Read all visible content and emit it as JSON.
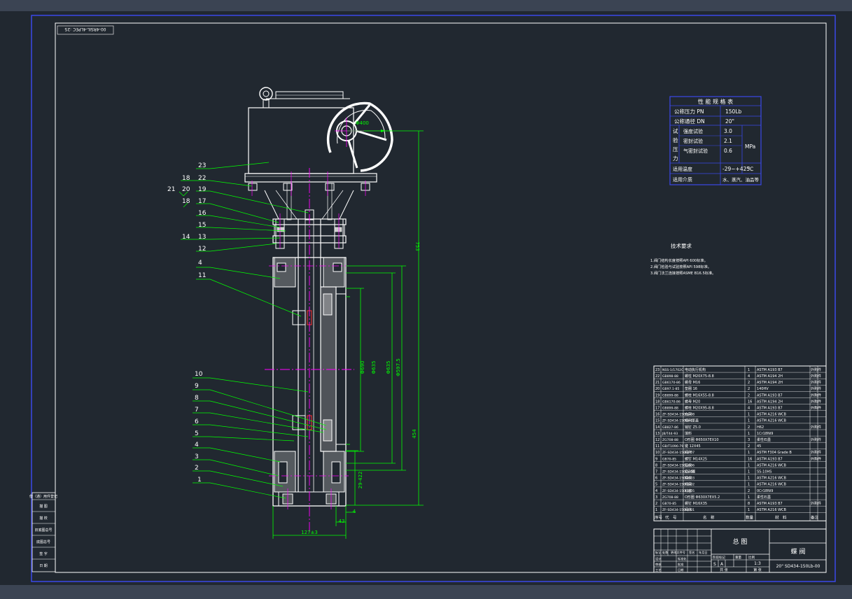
{
  "drawing_code_stamp": "00-4RSIL-4LPEC :2S",
  "spec_table": {
    "title": "性 能 规 格 表",
    "rows": [
      {
        "label": "公称压力 PN",
        "value": "150Lb"
      },
      {
        "label": "公称通径 DN",
        "value": "20\""
      }
    ],
    "test_label_chars": [
      "试",
      "验",
      "压",
      "力"
    ],
    "tests": [
      {
        "label": "强度试验",
        "value": "3.0"
      },
      {
        "label": "密封试验",
        "value": "2.1"
      },
      {
        "label": "气密封试验",
        "value": "0.6"
      }
    ],
    "pressure_unit": "MPa",
    "temp_label": "适用温度",
    "temp_value": "-29~+425",
    "temp_unit": "℃",
    "media_label": "适用介质",
    "media_value": "水、蒸汽、油品等"
  },
  "tech_requirements": {
    "title": "技术要求",
    "items": [
      "1.阀门结构长度按照API 600标准。",
      "2.阀门检验与试验按照API 598标准。",
      "3.阀门法兰连接按照ASME B16.5标准。"
    ]
  },
  "dimensions": {
    "handwheel_dia": "Φ400",
    "overall_height": "753",
    "stroke": "454",
    "dia_a": "Φ690",
    "dia_b": "Φ635",
    "dia_c": "Φ597.5",
    "flange_thk": "29-422",
    "width_43": "43",
    "gap_4": "4",
    "body_len": "127±3"
  },
  "part_labels": {
    "left": [
      "23",
      "18",
      "22",
      "21",
      "20",
      "19",
      "18",
      "17",
      "16",
      "15",
      "14",
      "13",
      "12",
      "4",
      "11",
      "10",
      "9",
      "8",
      "7",
      "6",
      "5",
      "4",
      "3",
      "2",
      "1"
    ]
  },
  "bom": {
    "rows": [
      {
        "no": "23",
        "code": "NSS-1/1702C",
        "name": "电动执行机构",
        "qty": "1",
        "mat": "ASTM A193 B7",
        "note": "外购件"
      },
      {
        "no": "22",
        "code": "GB898-88",
        "name": "螺柱 M20X75-8.8",
        "qty": "4",
        "mat": "ASTM A194 2H",
        "note": "外购件"
      },
      {
        "no": "21",
        "code": "GB6170-86",
        "name": "螺母 M16",
        "qty": "2",
        "mat": "ASTM A194 2H",
        "note": "外购件"
      },
      {
        "no": "20",
        "code": "GB97.1-85",
        "name": "垫圈 16",
        "qty": "2",
        "mat": "140HV",
        "note": "外购件"
      },
      {
        "no": "19",
        "code": "GB899-88",
        "name": "螺柱 M16X55-8.8",
        "qty": "2",
        "mat": "ASTM A193 B7",
        "note": "外购件"
      },
      {
        "no": "18",
        "code": "GB6170-86",
        "name": "螺母 M20",
        "qty": "16",
        "mat": "ASTM A194 2H",
        "note": "外购件"
      },
      {
        "no": "17",
        "code": "GB899-88",
        "name": "螺柱 M20X95-8.8",
        "qty": "4",
        "mat": "ASTM A193 B7",
        "note": "外购件"
      },
      {
        "no": "16",
        "code": "ZF-SD434-150Lb-08",
        "name": "支架",
        "qty": "1",
        "mat": "ASTM A216 WCB",
        "note": ""
      },
      {
        "no": "15",
        "code": "ZF-SD434-150Lb-07",
        "name": "填料压盖",
        "qty": "1",
        "mat": "ASTM A216 WCB",
        "note": ""
      },
      {
        "no": "14",
        "code": "GB827-86",
        "name": "销钉 Z5.0",
        "qty": "2",
        "mat": "H62",
        "note": "外购件"
      },
      {
        "no": "13",
        "code": "JB/T44-93",
        "name": "填料",
        "qty": "1",
        "mat": "1Cr18Ni9",
        "note": ""
      },
      {
        "no": "12",
        "code": "ZG708-88",
        "name": "O形圈 Φ650X7EX10",
        "qty": "3",
        "mat": "柔性石墨",
        "note": "外购件"
      },
      {
        "no": "11",
        "code": "GB/T1096-79",
        "name": "键 12X45",
        "qty": "2",
        "mat": "45",
        "note": ""
      },
      {
        "no": "10",
        "code": "ZF-SD434-150Lb-07",
        "name": "阀杆",
        "qty": "1",
        "mat": "ASTM F304 Grade B",
        "note": "外购件"
      },
      {
        "no": "9",
        "code": "GB70-85",
        "name": "螺钉 M14X25",
        "qty": "16",
        "mat": "ASTM A193 B7",
        "note": "外购件"
      },
      {
        "no": "8",
        "code": "ZF-SD434-150Lb-06",
        "name": "压板",
        "qty": "1",
        "mat": "ASTM A216 WCB",
        "note": ""
      },
      {
        "no": "7",
        "code": "ZF-SD434-150Lb-04",
        "name": "密封圈",
        "qty": "1",
        "mat": "SS-10HS",
        "note": ""
      },
      {
        "no": "6",
        "code": "ZF-SD434-150Lb-03",
        "name": "蝶板",
        "qty": "1",
        "mat": "ASTM A216 WCB",
        "note": ""
      },
      {
        "no": "5",
        "code": "ZF-SD434-150Lb-02",
        "name": "阀座",
        "qty": "1",
        "mat": "ASTM A216 WCB",
        "note": ""
      },
      {
        "no": "4",
        "code": "ZF-SD434-150Lb-05",
        "name": "衬套",
        "qty": "2",
        "mat": "0Cr18Ni9",
        "note": ""
      },
      {
        "no": "3",
        "code": "ZG708-88",
        "name": "O形圈 Φ630X7EX5.2",
        "qty": "1",
        "mat": "柔性石墨",
        "note": ""
      },
      {
        "no": "2",
        "code": "GB70-85",
        "name": "螺钉 M16X35",
        "qty": "8",
        "mat": "ASTM A193 B7",
        "note": "外购件"
      },
      {
        "no": "1",
        "code": "ZF-SD434-150Lb-01",
        "name": "阀体",
        "qty": "1",
        "mat": "ASTM A216 WCB",
        "note": ""
      }
    ],
    "header": [
      "序号",
      "代　号",
      "名　称",
      "数量",
      "材　料",
      "备注"
    ]
  },
  "title_block": {
    "drawing_name": "总 图",
    "product_name": "蝶 阀",
    "drawing_no": "20\" SD434-150Lb-00",
    "scale_label": "比例",
    "scale": "1:3",
    "stage_mark": "S",
    "stage_a": "A",
    "sheet_total": "共 张",
    "sheet_no": "第 张",
    "row_labels": [
      "设计",
      "审核",
      "工艺",
      "标准化",
      "批准",
      "日期"
    ],
    "col_labels": [
      "标记",
      "处数",
      "分区",
      "更改文件号",
      "签名",
      "年月日"
    ],
    "stage_label": "阶段标记",
    "weight_label": "重量"
  },
  "left_stamp": {
    "title": "借（通）用件登记",
    "rows": [
      "描 图",
      "描 校",
      "旧底图总号",
      "底图总号",
      "签 字",
      "日 期"
    ]
  }
}
